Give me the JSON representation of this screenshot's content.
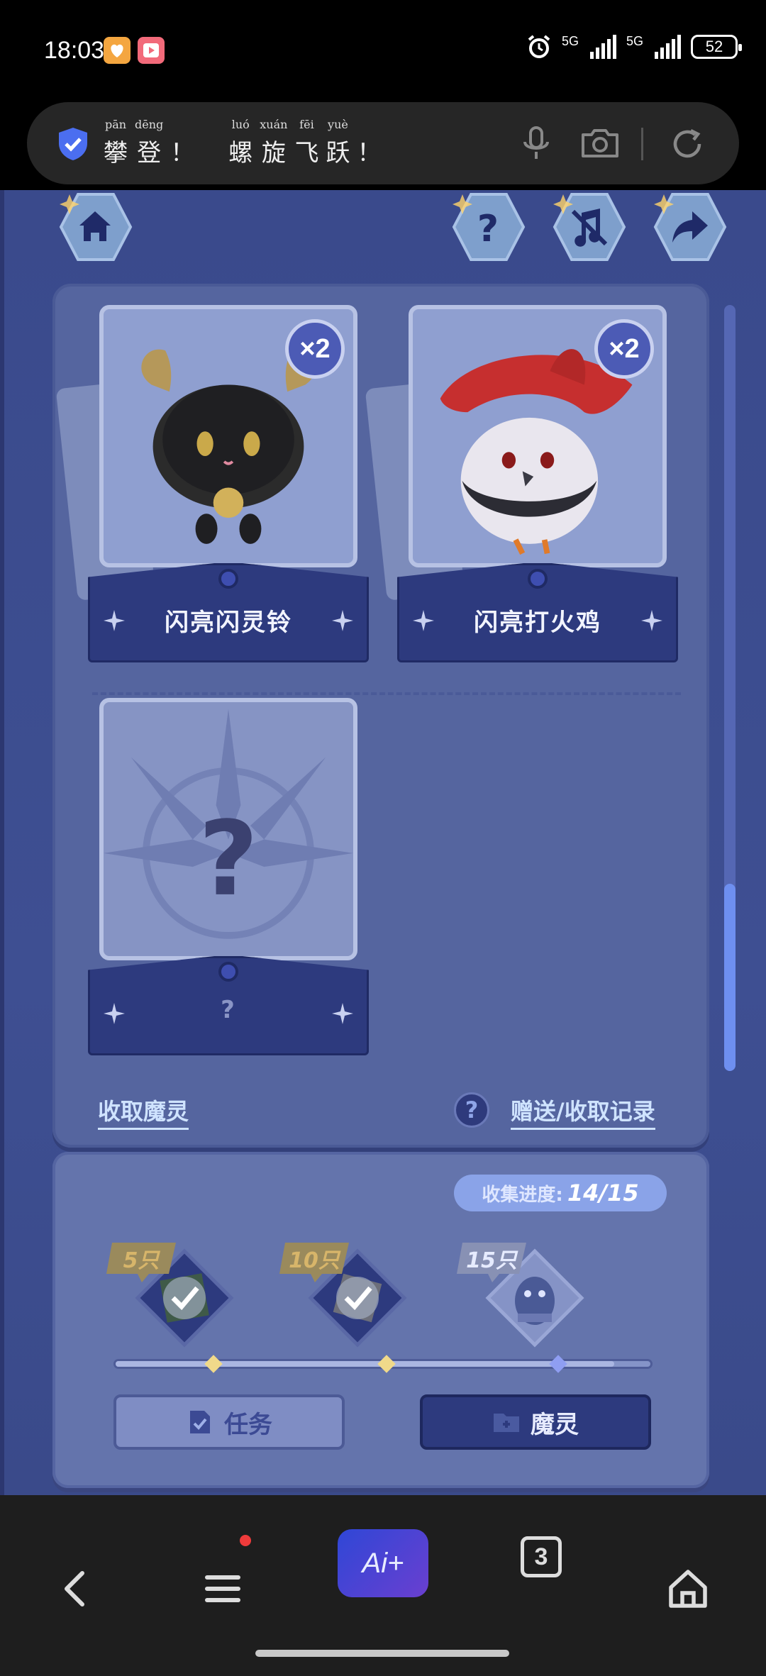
{
  "status_bar": {
    "time": "18:03",
    "network_1": "5G",
    "network_2": "5G",
    "battery": "52",
    "icons": [
      "orange-app-icon",
      "red-video-app-icon",
      "alarm-icon",
      "signal-icon",
      "battery-icon"
    ]
  },
  "search": {
    "words": [
      {
        "pinyin": "pān",
        "char": "攀"
      },
      {
        "pinyin": "dēng",
        "char": "登"
      },
      {
        "pinyin": "",
        "char": "！"
      },
      {
        "pinyin": "luó",
        "char": "螺"
      },
      {
        "pinyin": "xuán",
        "char": "旋"
      },
      {
        "pinyin": "fēi",
        "char": "飞"
      },
      {
        "pinyin": "yuè",
        "char": "跃"
      },
      {
        "pinyin": "",
        "char": "！"
      }
    ]
  },
  "cards": [
    {
      "name": "闪亮闪灵铃",
      "count_badge": "×2",
      "locked": false
    },
    {
      "name": "闪亮打火鸡",
      "count_badge": "×2",
      "locked": false
    },
    {
      "name": "?",
      "count_badge": "",
      "locked": true
    }
  ],
  "panel_links": {
    "collect": "收取魔灵",
    "help": "?",
    "records": "赠送/收取记录"
  },
  "progress": {
    "label": "收集进度:",
    "value": "14/15",
    "current": 14,
    "total": 15,
    "milestones": [
      {
        "tag": "5只",
        "done": true
      },
      {
        "tag": "10只",
        "done": true
      },
      {
        "tag": "15只",
        "done": false
      }
    ]
  },
  "tabs": {
    "tasks": "任务",
    "spirits": "魔灵"
  },
  "nav": {
    "ai_label": "Ai+",
    "tab_count": "3"
  },
  "colors": {
    "accent": "#2d3a7e",
    "panel": "#55659f",
    "scroll_thumb": "#6e8ff0"
  }
}
